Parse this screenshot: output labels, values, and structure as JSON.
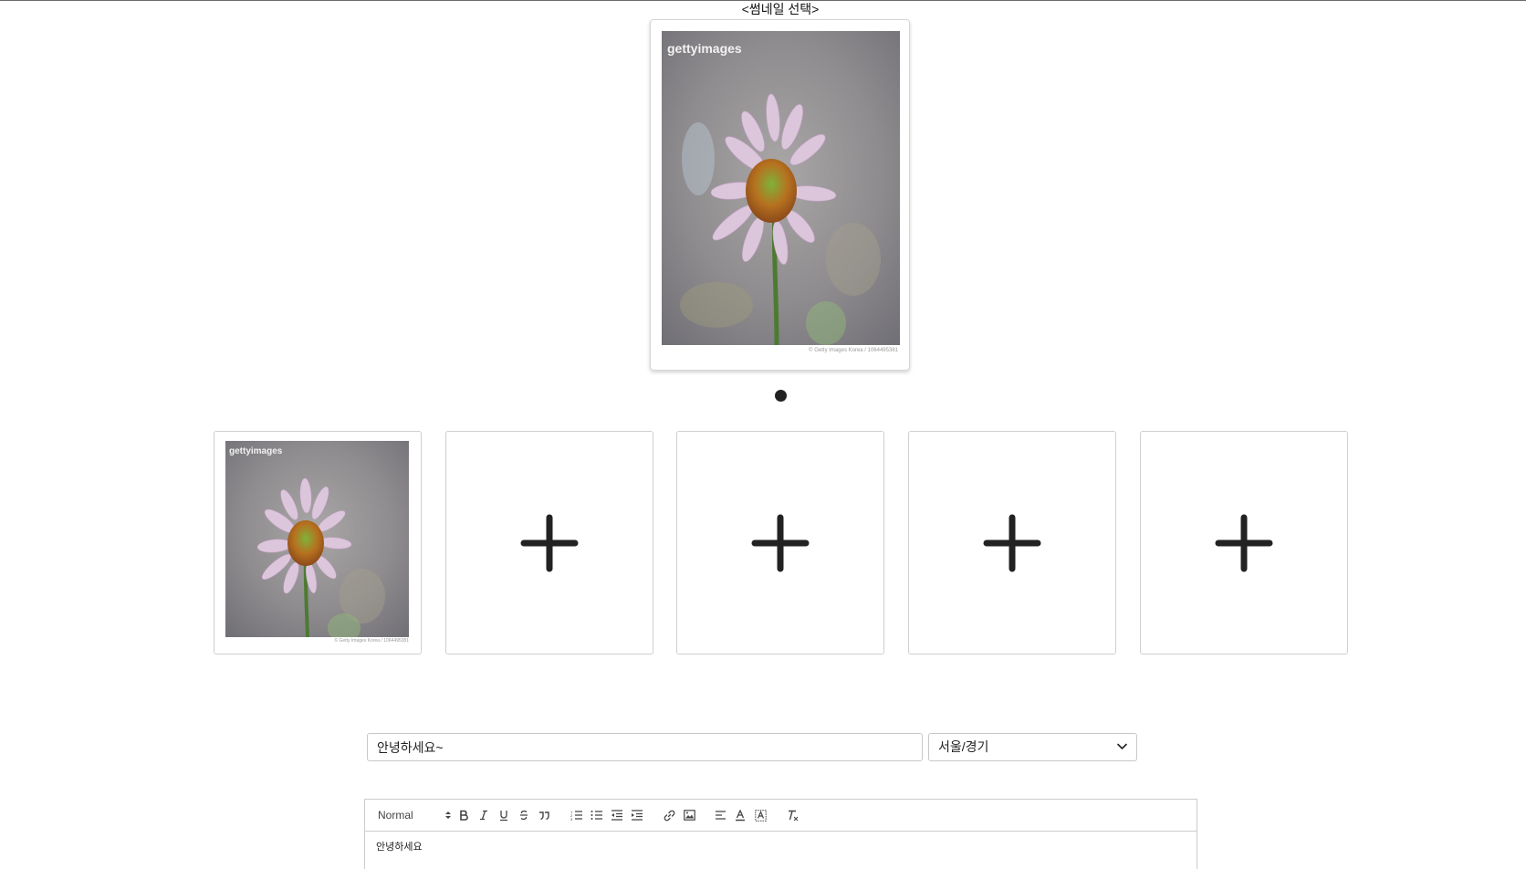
{
  "thumbnail_section": {
    "title": "<썸네일 선택>",
    "main_image": {
      "watermark": "gettyimages",
      "credit": "© Getty Images Korea / 1064495381"
    },
    "carousel_dot_count": 1
  },
  "image_slots": [
    {
      "state": "filled",
      "watermark": "gettyimages",
      "credit": "© Getty Images Korea / 1064495381"
    },
    {
      "state": "empty",
      "icon": "plus-icon"
    },
    {
      "state": "empty",
      "icon": "plus-icon"
    },
    {
      "state": "empty",
      "icon": "plus-icon"
    },
    {
      "state": "empty",
      "icon": "plus-icon"
    }
  ],
  "form": {
    "title_value": "안녕하세요~",
    "region_value": "서울/경기"
  },
  "editor": {
    "header_format": "Normal",
    "toolbar_icons": [
      "bold-icon",
      "italic-icon",
      "underline-icon",
      "strike-icon",
      "blockquote-icon",
      "ordered-list-icon",
      "bullet-list-icon",
      "outdent-icon",
      "indent-icon",
      "link-icon",
      "image-icon",
      "align-icon",
      "text-color-icon",
      "background-color-icon",
      "clear-format-icon"
    ],
    "content": "안녕하세요"
  },
  "colors": {
    "icon": "#222222",
    "border": "#cccccc",
    "dot": "#222222"
  }
}
